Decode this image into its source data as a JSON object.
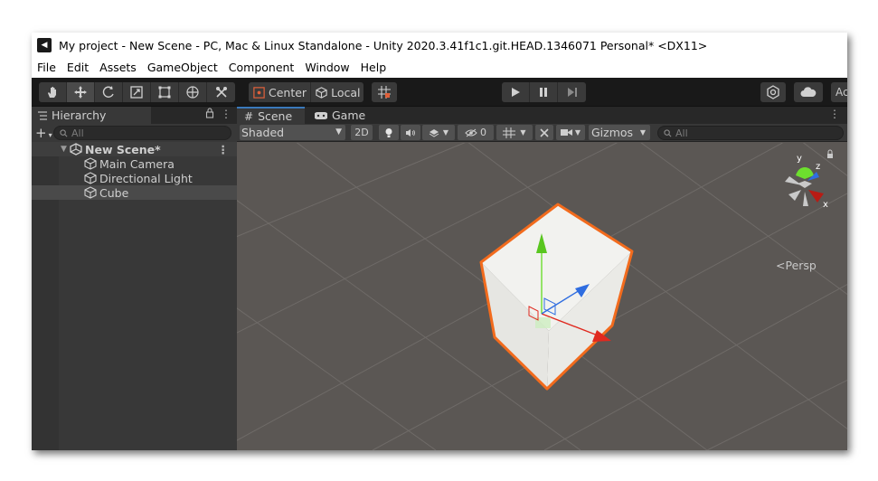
{
  "window": {
    "title": "My project - New Scene - PC, Mac & Linux Standalone - Unity 2020.3.41f1c1.git.HEAD.1346071 Personal* <DX11>"
  },
  "menu": [
    "File",
    "Edit",
    "Assets",
    "GameObject",
    "Component",
    "Window",
    "Help"
  ],
  "toolbar": {
    "tools": [
      "hand-icon",
      "move-icon",
      "rotate-icon",
      "scale-icon",
      "rect-icon",
      "transform-icon",
      "custom-tool-icon"
    ],
    "active_tool": "move-icon",
    "pivot_mode": "Center",
    "pivot_rotation": "Local",
    "right_partial_label": "Ac"
  },
  "hierarchy": {
    "tab_label": "Hierarchy",
    "search_placeholder": "All",
    "scene_name": "New Scene*",
    "items": [
      {
        "label": "Main Camera"
      },
      {
        "label": "Directional Light"
      },
      {
        "label": "Cube",
        "selected": true
      }
    ]
  },
  "scene_view": {
    "tabs": [
      "Scene",
      "Game"
    ],
    "active_tab": "Scene",
    "shading_mode": "Shaded",
    "toggle_2d": "2D",
    "hidden_count": "0",
    "gizmos_label": "Gizmos",
    "search_placeholder": "All",
    "projection_label": "Persp",
    "axis_labels": {
      "y": "y",
      "z": "z",
      "x": "x"
    },
    "colors": {
      "background": "#5b5754",
      "grid": "#6d6966",
      "selection_outline": "#f26b1d",
      "axis_x": "#e0291f",
      "axis_y": "#6ddf2e",
      "axis_z": "#2f6de0"
    }
  }
}
